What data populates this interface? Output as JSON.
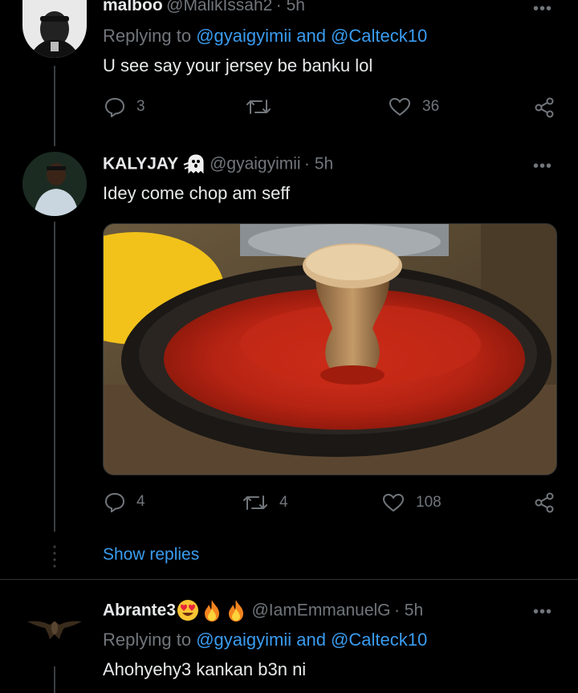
{
  "tweets": [
    {
      "name": "malboo",
      "handle": "@MalikIssah2",
      "time": "· 5h",
      "replying_prefix": "Replying to",
      "replying_users": "@gyaigyimii and @Calteck10",
      "text": "U see say your jersey be banku lol",
      "replies": "3",
      "retweets": "",
      "likes": "36"
    },
    {
      "name": "KALYJAY",
      "handle": "@gyaigyimii",
      "time": "· 5h",
      "text": "Idey come chop am seff",
      "replies": "4",
      "retweets": "4",
      "likes": "108",
      "name_icon": "ghost-emoji-icon"
    },
    {
      "name": "Abrante3",
      "handle": "@IamEmmanuelG",
      "time": "· 5h",
      "replying_prefix": "Replying to",
      "replying_users": "@gyaigyimii and @Calteck10",
      "text": "Ahohyehy3 kankan b3n ni",
      "name_icons": [
        "heart-eyes-emoji-icon",
        "fire-emoji-icon",
        "fire-emoji-icon"
      ]
    }
  ],
  "show_replies": "Show replies",
  "more_glyph": "•••",
  "colors": {
    "background": "#000000",
    "link": "#3a9cf0",
    "muted": "#71767b",
    "text": "#e7e9ea"
  }
}
